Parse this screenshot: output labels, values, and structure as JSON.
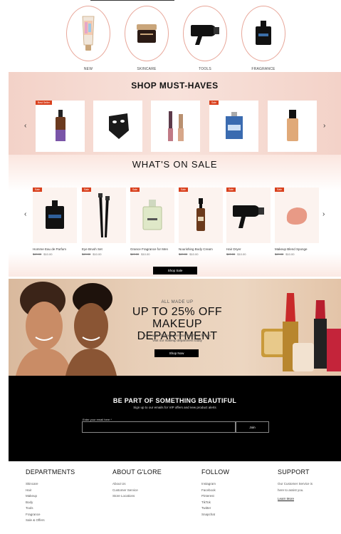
{
  "categories": [
    {
      "label": "NEW",
      "icon": "hand-cream-tube-icon"
    },
    {
      "label": "SKINCARE",
      "icon": "cream-jar-icon"
    },
    {
      "label": "TOOLS",
      "icon": "hair-dryer-icon"
    },
    {
      "label": "FRAGRANCE",
      "icon": "perfume-bottle-icon"
    }
  ],
  "must_haves": {
    "title": "SHOP MUST-HAVES",
    "items": [
      {
        "badge": "Best Seller",
        "icon": "serum-dropper-bottle-icon"
      },
      {
        "badge": "",
        "icon": "sheet-mask-icon"
      },
      {
        "badge": "",
        "icon": "lip-gloss-icon"
      },
      {
        "badge": "Sale",
        "icon": "perfume-bottle-icon"
      },
      {
        "badge": "",
        "icon": "foundation-bottle-icon"
      }
    ]
  },
  "sale": {
    "title": "WHAT'S ON SALE",
    "badge": "Sale",
    "button": "Shop Sale",
    "items": [
      {
        "name": "Homme Eau de Parfum",
        "old_price": "$49.00",
        "price": "$10.00",
        "icon": "cologne-bottle-icon"
      },
      {
        "name": "Eye Brush Set",
        "old_price": "$49.00",
        "price": "$10.00",
        "icon": "brush-set-icon"
      },
      {
        "name": "Grance Fragrance for Men",
        "old_price": "$49.00",
        "price": "$10.00",
        "icon": "fragrance-bottle-icon"
      },
      {
        "name": "Nourishing Body Cream",
        "old_price": "$49.00",
        "price": "$10.00",
        "icon": "pump-bottle-icon"
      },
      {
        "name": "Hair Dryer",
        "old_price": "$49.00",
        "price": "$10.00",
        "icon": "hair-dryer-icon"
      },
      {
        "name": "Makeup Blend Sponge",
        "old_price": "$49.00",
        "price": "$10.00",
        "icon": "sponge-icon"
      }
    ]
  },
  "banner": {
    "eyebrow": "ALL MADE UP",
    "headline_1": "UP TO 25% OFF",
    "headline_2": "MAKEUP DEPARTMENT",
    "sub_1": "Don't wait! This exclusive deal won't last forever",
    "sub_2": "Visit our makeup department today",
    "button": "Shop Now"
  },
  "newsletter": {
    "title": "BE PART OF SOMETHING BEAUTIFUL",
    "subtitle": "Sign up to our emails for VIP offers and new product alerts",
    "email_label": "Enter your email here *",
    "email_value": "",
    "button": "Join"
  },
  "footer": {
    "departments": {
      "title": "DEPARTMENTS",
      "items": [
        "Skincare",
        "Hair",
        "Makeup",
        "Body",
        "Tools",
        "Fragrance",
        "Sale & Offers"
      ]
    },
    "about": {
      "title": "ABOUT G'LORE",
      "items": [
        "About Us",
        "Customer Service",
        "Store Locations"
      ]
    },
    "follow": {
      "title": "FOLLOW",
      "items": [
        "Instagram",
        "Facebook",
        "Pinterest",
        "TikTok",
        "Twitter",
        "Snapchat"
      ]
    },
    "support": {
      "title": "SUPPORT",
      "text_1": "Our Customer Service is",
      "text_2": "here to assist you.",
      "link": "Learn More"
    }
  },
  "colors": {
    "accent": "#d9411e",
    "pink_bg": "#f3d2c8",
    "black": "#000000"
  }
}
